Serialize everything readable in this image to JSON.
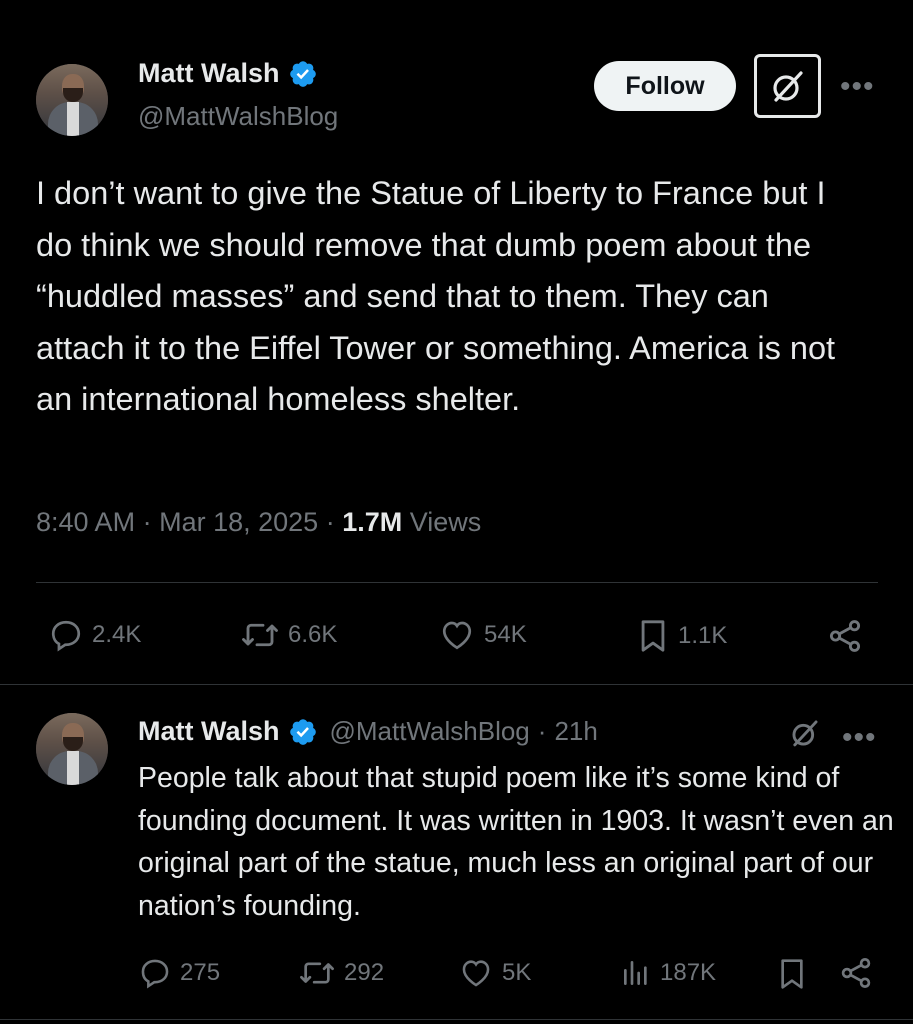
{
  "main_tweet": {
    "author_name": "Matt Walsh",
    "author_handle": "@MattWalshBlog",
    "follow_label": "Follow",
    "text": "I don’t want to give the Statue of Liberty to France but I do think we should remove that dumb poem about the “huddled masses” and send that to them. They can attach it to the Eiffel Tower or something. America is not an international homeless shelter.",
    "time": "8:40 AM",
    "date": "Mar 18, 2025",
    "views_count": "1.7M",
    "views_label": "Views",
    "stats": {
      "replies": "2.4K",
      "reposts": "6.6K",
      "likes": "54K",
      "bookmarks": "1.1K"
    }
  },
  "reply": {
    "author_name": "Matt Walsh",
    "author_handle": "@MattWalshBlog",
    "age": "21h",
    "text": "People talk about that stupid poem like it’s some kind of founding document. It was written in 1903. It wasn’t even an original part of the statue, much less an original part of our nation’s founding.",
    "stats": {
      "replies": "275",
      "reposts": "292",
      "likes": "5K",
      "views": "187K"
    }
  },
  "colors": {
    "background": "#000000",
    "text": "#e7e9ea",
    "muted": "#71767b",
    "verified": "#1d9bf0",
    "divider": "#2f3336"
  },
  "icons": [
    "verified-badge-icon",
    "grok-icon",
    "more-icon",
    "reply-icon",
    "repost-icon",
    "like-icon",
    "bookmark-icon",
    "share-icon",
    "views-icon"
  ]
}
